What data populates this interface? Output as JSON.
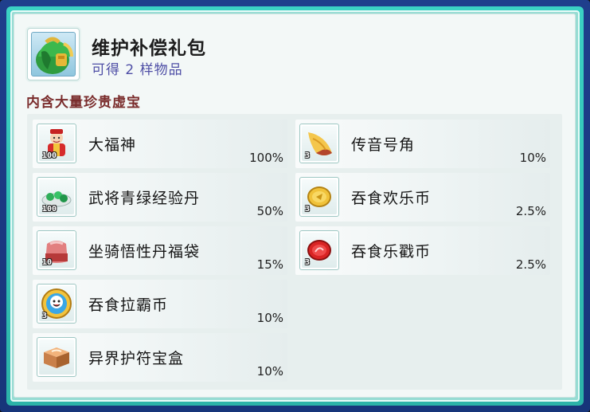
{
  "header": {
    "title": "维护补偿礼包",
    "subtitle": "可得 2 样物品",
    "icon": "green-backpack-icon"
  },
  "section": {
    "label": "内含大量珍贵虚宝"
  },
  "items": [
    {
      "name": "大福神",
      "count": "100",
      "rate": "100%",
      "icon": "fortune-god-icon"
    },
    {
      "name": "传音号角",
      "count": "3",
      "rate": "10%",
      "icon": "horn-icon"
    },
    {
      "name": "武将青绿经验丹",
      "count": "100",
      "rate": "50%",
      "icon": "green-exp-pill-icon"
    },
    {
      "name": "吞食欢乐币",
      "count": "3",
      "rate": "2.5%",
      "icon": "gold-coin-icon"
    },
    {
      "name": "坐骑悟性丹福袋",
      "count": "10",
      "rate": "15%",
      "icon": "red-lucky-bag-icon"
    },
    {
      "name": "吞食乐戳币",
      "count": "3",
      "rate": "2.5%",
      "icon": "red-coin-icon"
    },
    {
      "name": "吞食拉霸币",
      "count": "3",
      "rate": "10%",
      "icon": "slot-coin-icon"
    },
    {
      "name": "异界护符宝盒",
      "count": "",
      "rate": "10%",
      "icon": "amulet-box-icon"
    }
  ],
  "colors": {
    "frame_outer": "#1f3f8c",
    "frame_teal": "#3bd2c4",
    "panel_bg": "#f3f8f7",
    "title_text": "#1d1d1d",
    "subtitle_text": "#4f4fa6",
    "section_text": "#7a2c2c"
  }
}
